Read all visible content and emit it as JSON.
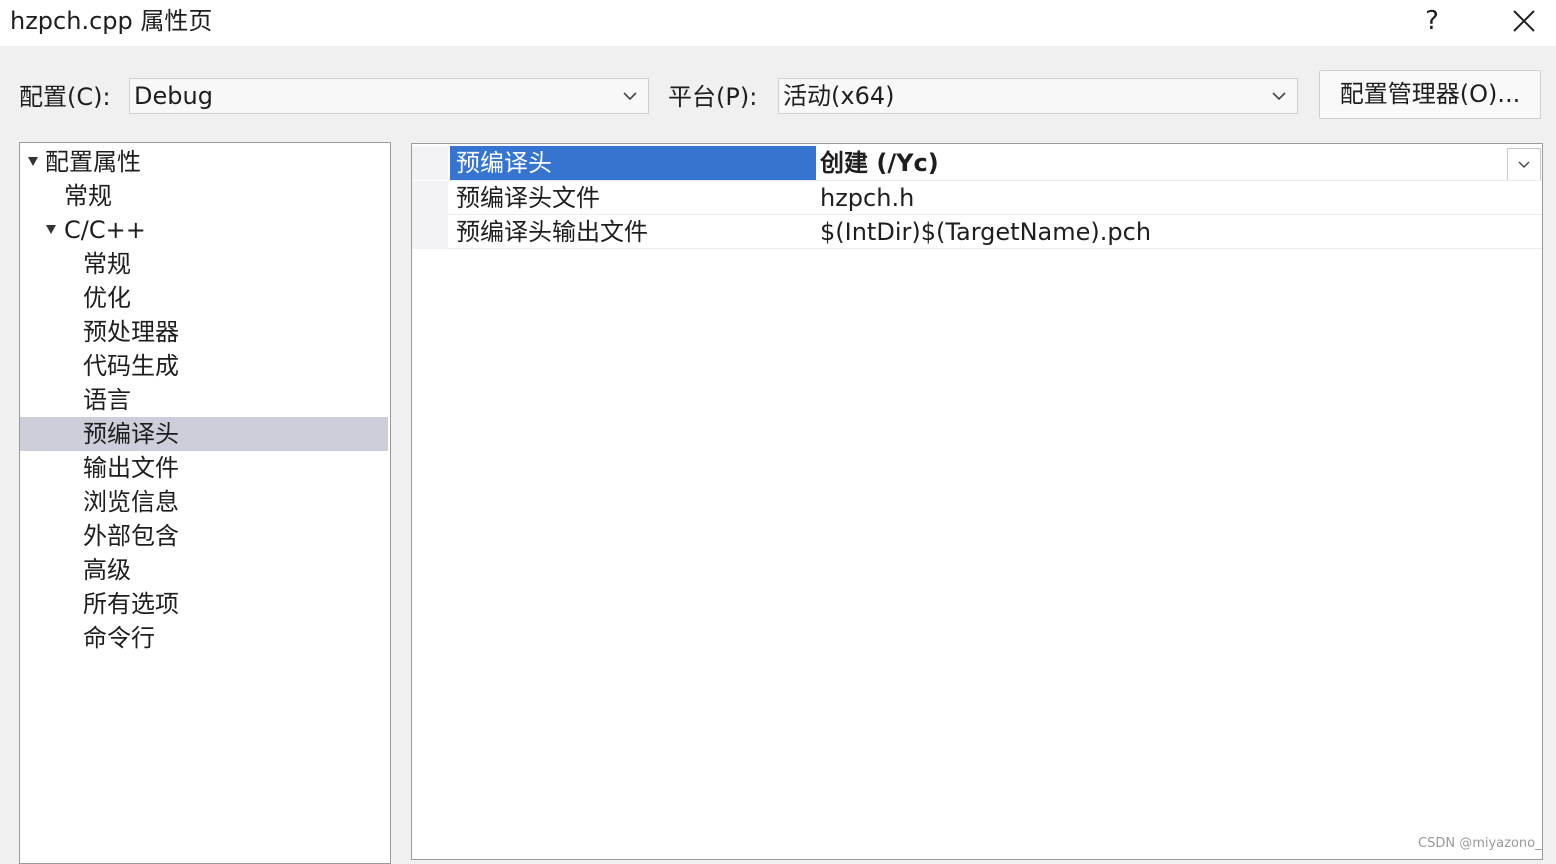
{
  "window": {
    "title": "hzpch.cpp 属性页",
    "help_label": "?"
  },
  "toolbar": {
    "config_label": "配置(C):",
    "config_value": "Debug",
    "platform_label": "平台(P):",
    "platform_value": "活动(x64)",
    "config_manager_label": "配置管理器(O)..."
  },
  "tree": {
    "root": "配置属性",
    "general": "常规",
    "cpp": "C/C++",
    "children": [
      "常规",
      "优化",
      "预处理器",
      "代码生成",
      "语言",
      "预编译头",
      "输出文件",
      "浏览信息",
      "外部包含",
      "高级",
      "所有选项",
      "命令行"
    ],
    "selected": "预编译头"
  },
  "properties": [
    {
      "name": "预编译头",
      "value": "创建 (/Yc)"
    },
    {
      "name": "预编译头文件",
      "value": "hzpch.h"
    },
    {
      "name": "预编译头输出文件",
      "value": "$(IntDir)$(TargetName).pch"
    }
  ],
  "watermark": "CSDN @miyazono_"
}
